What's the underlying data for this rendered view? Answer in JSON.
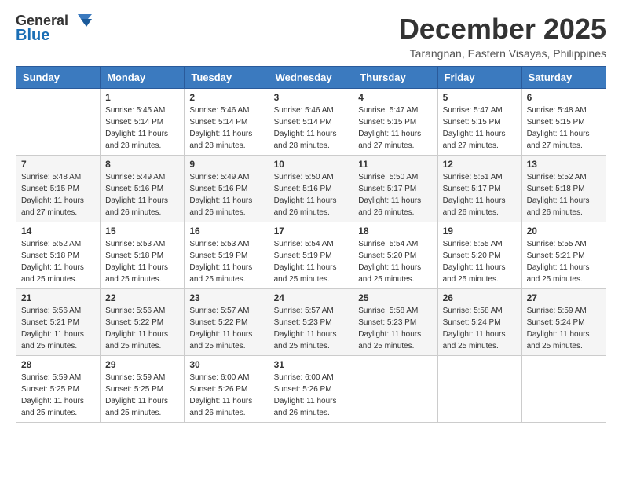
{
  "header": {
    "logo_line1": "General",
    "logo_line2": "Blue",
    "month_year": "December 2025",
    "location": "Tarangnan, Eastern Visayas, Philippines"
  },
  "days_of_week": [
    "Sunday",
    "Monday",
    "Tuesday",
    "Wednesday",
    "Thursday",
    "Friday",
    "Saturday"
  ],
  "weeks": [
    [
      {
        "day": "",
        "sunrise": "",
        "sunset": "",
        "daylight": ""
      },
      {
        "day": "1",
        "sunrise": "5:45 AM",
        "sunset": "5:14 PM",
        "daylight": "11 hours and 28 minutes."
      },
      {
        "day": "2",
        "sunrise": "5:46 AM",
        "sunset": "5:14 PM",
        "daylight": "11 hours and 28 minutes."
      },
      {
        "day": "3",
        "sunrise": "5:46 AM",
        "sunset": "5:14 PM",
        "daylight": "11 hours and 28 minutes."
      },
      {
        "day": "4",
        "sunrise": "5:47 AM",
        "sunset": "5:15 PM",
        "daylight": "11 hours and 27 minutes."
      },
      {
        "day": "5",
        "sunrise": "5:47 AM",
        "sunset": "5:15 PM",
        "daylight": "11 hours and 27 minutes."
      },
      {
        "day": "6",
        "sunrise": "5:48 AM",
        "sunset": "5:15 PM",
        "daylight": "11 hours and 27 minutes."
      }
    ],
    [
      {
        "day": "7",
        "sunrise": "5:48 AM",
        "sunset": "5:15 PM",
        "daylight": "11 hours and 27 minutes."
      },
      {
        "day": "8",
        "sunrise": "5:49 AM",
        "sunset": "5:16 PM",
        "daylight": "11 hours and 26 minutes."
      },
      {
        "day": "9",
        "sunrise": "5:49 AM",
        "sunset": "5:16 PM",
        "daylight": "11 hours and 26 minutes."
      },
      {
        "day": "10",
        "sunrise": "5:50 AM",
        "sunset": "5:16 PM",
        "daylight": "11 hours and 26 minutes."
      },
      {
        "day": "11",
        "sunrise": "5:50 AM",
        "sunset": "5:17 PM",
        "daylight": "11 hours and 26 minutes."
      },
      {
        "day": "12",
        "sunrise": "5:51 AM",
        "sunset": "5:17 PM",
        "daylight": "11 hours and 26 minutes."
      },
      {
        "day": "13",
        "sunrise": "5:52 AM",
        "sunset": "5:18 PM",
        "daylight": "11 hours and 26 minutes."
      }
    ],
    [
      {
        "day": "14",
        "sunrise": "5:52 AM",
        "sunset": "5:18 PM",
        "daylight": "11 hours and 25 minutes."
      },
      {
        "day": "15",
        "sunrise": "5:53 AM",
        "sunset": "5:18 PM",
        "daylight": "11 hours and 25 minutes."
      },
      {
        "day": "16",
        "sunrise": "5:53 AM",
        "sunset": "5:19 PM",
        "daylight": "11 hours and 25 minutes."
      },
      {
        "day": "17",
        "sunrise": "5:54 AM",
        "sunset": "5:19 PM",
        "daylight": "11 hours and 25 minutes."
      },
      {
        "day": "18",
        "sunrise": "5:54 AM",
        "sunset": "5:20 PM",
        "daylight": "11 hours and 25 minutes."
      },
      {
        "day": "19",
        "sunrise": "5:55 AM",
        "sunset": "5:20 PM",
        "daylight": "11 hours and 25 minutes."
      },
      {
        "day": "20",
        "sunrise": "5:55 AM",
        "sunset": "5:21 PM",
        "daylight": "11 hours and 25 minutes."
      }
    ],
    [
      {
        "day": "21",
        "sunrise": "5:56 AM",
        "sunset": "5:21 PM",
        "daylight": "11 hours and 25 minutes."
      },
      {
        "day": "22",
        "sunrise": "5:56 AM",
        "sunset": "5:22 PM",
        "daylight": "11 hours and 25 minutes."
      },
      {
        "day": "23",
        "sunrise": "5:57 AM",
        "sunset": "5:22 PM",
        "daylight": "11 hours and 25 minutes."
      },
      {
        "day": "24",
        "sunrise": "5:57 AM",
        "sunset": "5:23 PM",
        "daylight": "11 hours and 25 minutes."
      },
      {
        "day": "25",
        "sunrise": "5:58 AM",
        "sunset": "5:23 PM",
        "daylight": "11 hours and 25 minutes."
      },
      {
        "day": "26",
        "sunrise": "5:58 AM",
        "sunset": "5:24 PM",
        "daylight": "11 hours and 25 minutes."
      },
      {
        "day": "27",
        "sunrise": "5:59 AM",
        "sunset": "5:24 PM",
        "daylight": "11 hours and 25 minutes."
      }
    ],
    [
      {
        "day": "28",
        "sunrise": "5:59 AM",
        "sunset": "5:25 PM",
        "daylight": "11 hours and 25 minutes."
      },
      {
        "day": "29",
        "sunrise": "5:59 AM",
        "sunset": "5:25 PM",
        "daylight": "11 hours and 25 minutes."
      },
      {
        "day": "30",
        "sunrise": "6:00 AM",
        "sunset": "5:26 PM",
        "daylight": "11 hours and 26 minutes."
      },
      {
        "day": "31",
        "sunrise": "6:00 AM",
        "sunset": "5:26 PM",
        "daylight": "11 hours and 26 minutes."
      },
      {
        "day": "",
        "sunrise": "",
        "sunset": "",
        "daylight": ""
      },
      {
        "day": "",
        "sunrise": "",
        "sunset": "",
        "daylight": ""
      },
      {
        "day": "",
        "sunrise": "",
        "sunset": "",
        "daylight": ""
      }
    ]
  ],
  "labels": {
    "sunrise_prefix": "Sunrise: ",
    "sunset_prefix": "Sunset: ",
    "daylight_label": "Daylight: "
  }
}
